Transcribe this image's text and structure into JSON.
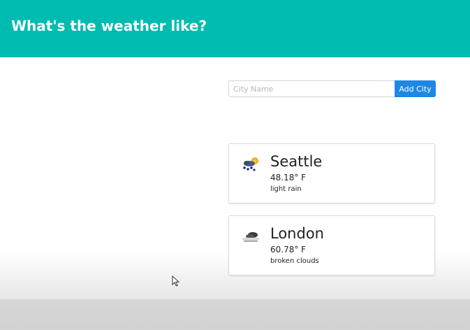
{
  "header": {
    "title": "What's the weather like?"
  },
  "search": {
    "placeholder": "City Name",
    "value": "",
    "add_button_label": "Add City"
  },
  "cities": [
    {
      "name": "Seattle",
      "temperature": "48.18° F",
      "description": "light rain",
      "icon": "rain-sun-icon"
    },
    {
      "name": "London",
      "temperature": "60.78° F",
      "description": "broken clouds",
      "icon": "broken-clouds-icon"
    }
  ],
  "colors": {
    "header_bg": "#00bbb0",
    "button_bg": "#1e88e5"
  }
}
